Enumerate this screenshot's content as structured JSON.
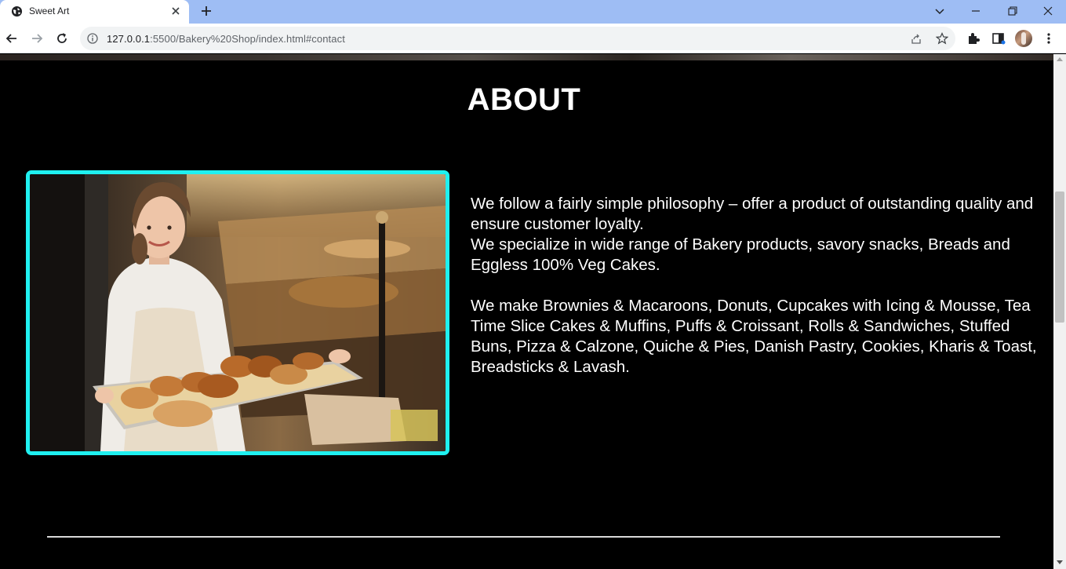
{
  "browser": {
    "tab_title": "Sweet Art",
    "url_host": "127.0.0.1",
    "url_path": ":5500/Bakery%20Shop/index.html#contact",
    "icons": [
      "globe-icon",
      "close-icon",
      "new-tab-icon",
      "back-icon",
      "forward-icon",
      "reload-icon",
      "info-icon",
      "share-icon",
      "star-icon",
      "puzzle-icon",
      "sidebar-icon",
      "kebab-menu-icon"
    ]
  },
  "about": {
    "title": "ABOUT",
    "paragraph1_line1": "We follow a fairly simple philosophy – offer a product of outstanding quality and ensure customer loyalty.",
    "paragraph1_line2": "We specialize in wide range of Bakery products, savory snacks, Breads and Eggless 100% Veg Cakes.",
    "paragraph2": "We make Brownies & Macaroons, Donuts, Cupcakes with Icing & Mousse, Tea Time Slice Cakes & Muffins, Puffs & Croissant, Rolls & Sandwiches, Stuffed Buns, Pizza & Calzone, Quiche & Pies, Danish Pastry, Cookies, Kharis & Toast, Breadsticks & Lavash.",
    "image_subject": "baker-holding-pastry-tray"
  },
  "colors": {
    "page_bg": "#000000",
    "frame_border": "#1ff0f0",
    "text": "#ffffff",
    "divider": "#d9d9d9"
  }
}
